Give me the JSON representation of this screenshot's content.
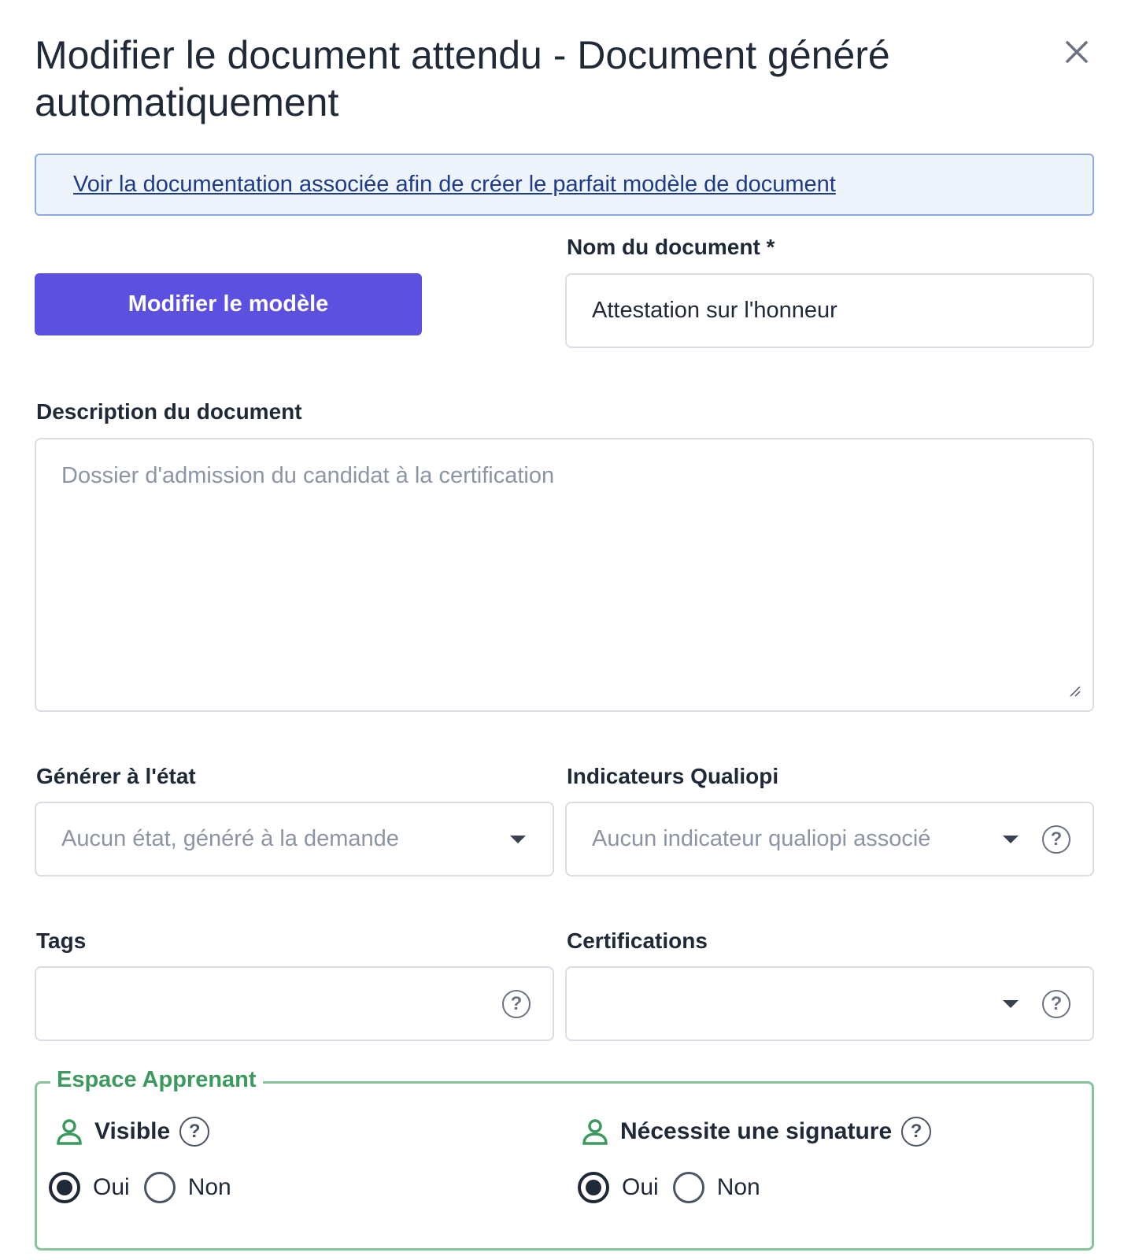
{
  "dialog": {
    "title": "Modifier le document attendu - Document généré automatiquement"
  },
  "banner": {
    "link_text": "Voir la documentation associée afin de créer le parfait modèle de document"
  },
  "template_button": {
    "label": "Modifier le modèle"
  },
  "document_name": {
    "label": "Nom du document *",
    "value": "Attestation sur l'honneur"
  },
  "description": {
    "label": "Description du document",
    "placeholder": "Dossier d'admission du candidat à la certification"
  },
  "generate_state": {
    "label": "Générer à l'état",
    "placeholder": "Aucun état, généré à la demande"
  },
  "qualiopi": {
    "label": "Indicateurs Qualiopi",
    "placeholder": "Aucun indicateur qualiopi associé"
  },
  "tags": {
    "label": "Tags",
    "value": ""
  },
  "certifications": {
    "label": "Certifications",
    "value": ""
  },
  "learner_space": {
    "legend": "Espace Apprenant",
    "visible": {
      "label": "Visible",
      "options": [
        "Oui",
        "Non"
      ],
      "selected": "Oui"
    },
    "signature": {
      "label": "Nécessite une signature",
      "options": [
        "Oui",
        "Non"
      ],
      "selected": "Oui"
    }
  },
  "icons": {
    "close": "close-icon",
    "help": "help-circle-icon",
    "person": "person-icon",
    "dropdown": "caret-down-icon"
  },
  "colors": {
    "primary": "#5b50e0",
    "banner_bg": "#eef4fc",
    "banner_border": "#8aa9e6",
    "success": "#3c9a5f"
  }
}
